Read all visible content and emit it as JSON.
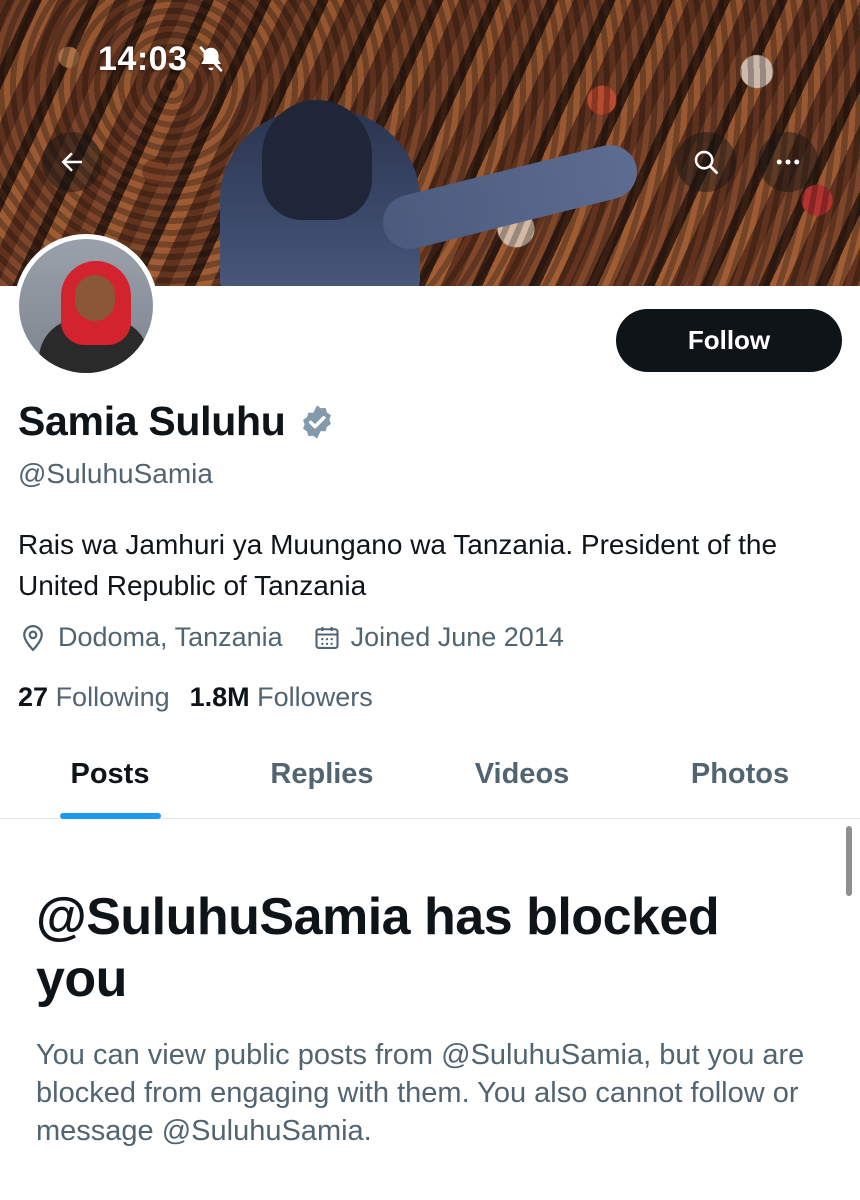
{
  "status_bar": {
    "time": "14:03"
  },
  "profile": {
    "display_name": "Samia Suluhu",
    "handle": "@SuluhuSamia",
    "bio": "Rais wa Jamhuri ya Muungano wa Tanzania. President of the United Republic of Tanzania",
    "location": "Dodoma, Tanzania",
    "joined": "Joined June 2014",
    "following_count": "27",
    "following_label": "Following",
    "followers_count": "1.8M",
    "followers_label": "Followers",
    "verified": true
  },
  "actions": {
    "follow_label": "Follow"
  },
  "tabs": [
    {
      "label": "Posts",
      "active": true
    },
    {
      "label": "Replies",
      "active": false
    },
    {
      "label": "Videos",
      "active": false
    },
    {
      "label": "Photos",
      "active": false
    }
  ],
  "blocked": {
    "title": "@SuluhuSamia has blocked you",
    "description": "You can view public posts from @SuluhuSamia, but you are blocked from engaging with them. You also cannot follow or message @SuluhuSamia."
  },
  "colors": {
    "text_primary": "#0f1419",
    "text_secondary": "#536471",
    "accent": "#1d9bf0",
    "button_bg": "#0f1419"
  },
  "icons": {
    "back": "arrow-left-icon",
    "search": "search-icon",
    "more": "more-horizontal-icon",
    "verified": "verified-badge-icon",
    "location": "location-pin-icon",
    "calendar": "calendar-icon",
    "bell": "bell-off-icon"
  }
}
